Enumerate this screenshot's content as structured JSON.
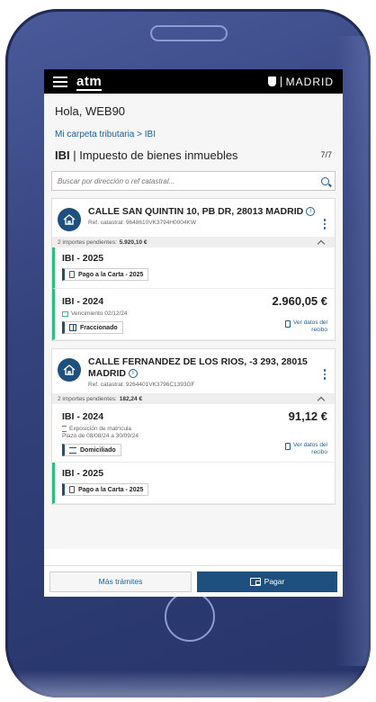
{
  "header": {
    "logo": "atm",
    "city": "MADRID"
  },
  "greeting": "Hola, WEB90",
  "breadcrumb": "Mi carpeta tributaria > IBI",
  "page": {
    "title_strong": "IBI",
    "title_rest": " | Impuesto de bienes inmuebles",
    "counter": "7/7"
  },
  "search": {
    "placeholder": "Buscar por dirección o ref catastral..."
  },
  "properties": [
    {
      "address": "CALLE SAN QUINTIN 10, PB DR, 28013 MADRID",
      "ref": "Ref. catastral: 9648610VK3794H0004KW",
      "pending_label": "2 importes pendientes:",
      "pending_amount": "5.920,10 €",
      "items": [
        {
          "year": "IBI - 2025",
          "chip": "Pago a la Carta - 2025",
          "chip_icon": "document-icon"
        },
        {
          "year": "IBI - 2024",
          "amount": "2.960,05 €",
          "meta": "Vencimiento 02/12/24",
          "meta_icon": "calendar-icon",
          "chip": "Fraccionado",
          "chip_icon": "split-icon",
          "link_line1": "Ver datos del",
          "link_line2": "recibo"
        }
      ]
    },
    {
      "address": "CALLE FERNANDEZ DE LOS RIOS, -3 293, 28015 MADRID",
      "ref": "Ref. catastral: 9264401VK3796C1393GF",
      "pending_label": "2 importes pendientes:",
      "pending_amount": "182,24 €",
      "items": [
        {
          "year": "IBI - 2024",
          "amount": "91,12 €",
          "meta": "Exposición de matrícula",
          "meta2": "Plazo de 08/08/24 a 30/09/24",
          "meta_icon": "hourglass-icon",
          "chip": "Domiciliado",
          "chip_icon": "bank-icon",
          "link_line1": "Ver datos del",
          "link_line2": "recibo"
        },
        {
          "year": "IBI - 2025",
          "chip": "Pago a la Carta - 2025",
          "chip_icon": "document-icon"
        }
      ]
    }
  ],
  "footer": {
    "more_label": "Más trámites",
    "pay_label": "Pagar"
  },
  "colors": {
    "primary": "#1d4f7f",
    "accent": "#2dbe7f",
    "link": "#1b5fa0"
  }
}
